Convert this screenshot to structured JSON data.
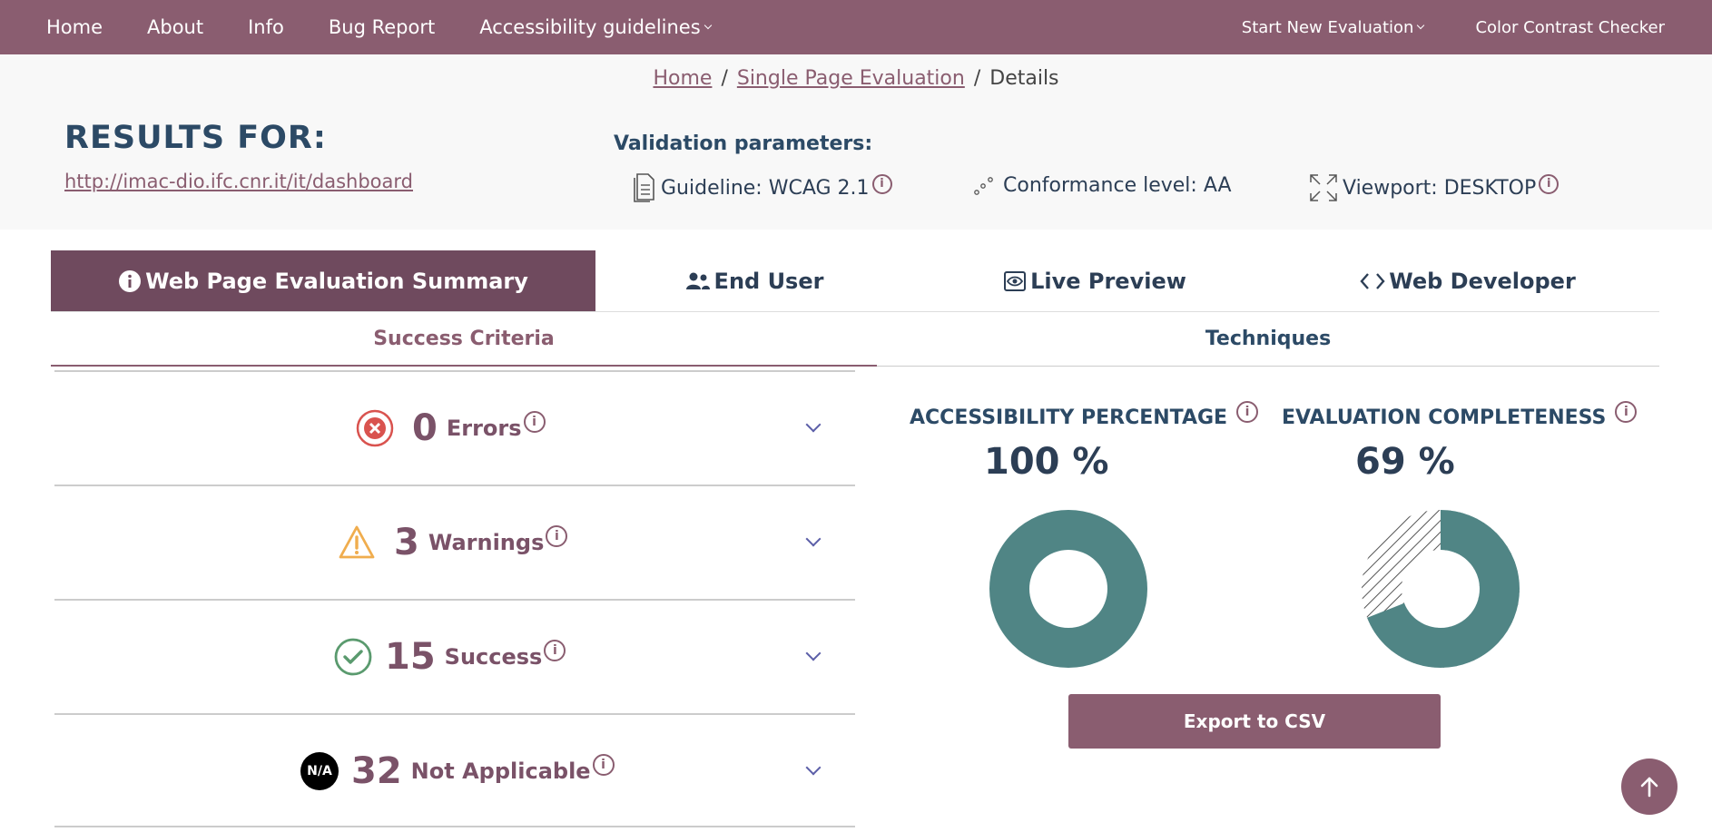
{
  "nav": {
    "items": [
      "Home",
      "About",
      "Info",
      "Bug Report"
    ],
    "guidelines_label": "Accessibility guidelines",
    "start_eval_label": "Start New Evaluation",
    "contrast_label": "Color Contrast Checker"
  },
  "breadcrumb": {
    "home": "Home",
    "single": "Single Page Evaluation",
    "current": "Details",
    "separator": "/"
  },
  "results": {
    "title": "RESULTS FOR:",
    "url": "http://imac-dio.ifc.cnr.it/it/dashboard"
  },
  "validation": {
    "title": "Validation parameters:",
    "guideline": "Guideline: WCAG 2.1",
    "conformance": "Conformance level: AA",
    "viewport": "Viewport: DESKTOP"
  },
  "tabs": {
    "summary": "Web Page Evaluation Summary",
    "end_user": "End User",
    "live_preview": "Live Preview",
    "web_dev": "Web Developer"
  },
  "subtabs": {
    "criteria": "Success Criteria",
    "techniques": "Techniques"
  },
  "criteria": {
    "errors": {
      "count": "0",
      "label": "Errors"
    },
    "warnings": {
      "count": "3",
      "label": "Warnings"
    },
    "success": {
      "count": "15",
      "label": "Success"
    },
    "na": {
      "count": "32",
      "label": "Not Applicable",
      "badge": "N/A"
    }
  },
  "stats": {
    "accessibility": {
      "title": "ACCESSIBILITY PERCENTAGE",
      "value": "100 %",
      "fraction": 1.0
    },
    "completeness": {
      "title": "EVALUATION COMPLETENESS",
      "value": "69 %",
      "fraction": 0.69
    }
  },
  "export_label": "Export to CSV",
  "colors": {
    "primary": "#8a5d70",
    "donut": "#508585",
    "error": "#d9534f",
    "warning": "#f0ad4e",
    "success": "#5a9a6e"
  }
}
